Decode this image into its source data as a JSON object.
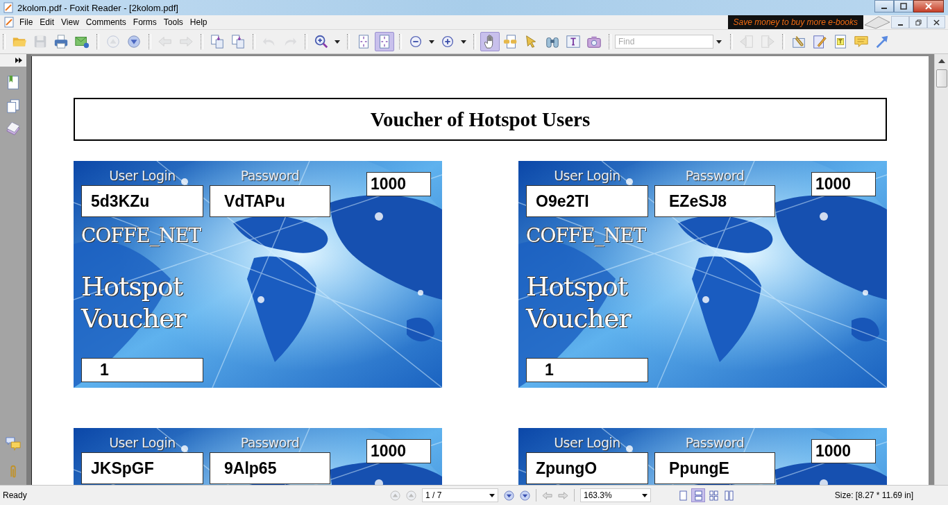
{
  "window": {
    "title": "2kolom.pdf - Foxit Reader - [2kolom.pdf]"
  },
  "menu": [
    "File",
    "Edit",
    "View",
    "Comments",
    "Forms",
    "Tools",
    "Help"
  ],
  "ad_banner": "Save money to buy more e-books",
  "toolbar": {
    "buttons": [
      {
        "selected": false,
        "disabled": false
      },
      {
        "selected": false,
        "disabled": true
      },
      {
        "selected": false,
        "disabled": false
      },
      {
        "selected": false,
        "disabled": false
      },
      {
        "selected": false,
        "disabled": true
      },
      {
        "selected": false,
        "disabled": false
      },
      {
        "selected": false,
        "disabled": true
      },
      {
        "selected": false,
        "disabled": true
      },
      {
        "selected": false,
        "disabled": false
      },
      {
        "selected": false,
        "disabled": false
      },
      {
        "selected": false,
        "disabled": true
      },
      {
        "selected": false,
        "disabled": true
      },
      {
        "selected": false,
        "disabled": false
      },
      {
        "selected": false,
        "disabled": false
      },
      {
        "selected": false,
        "disabled": false
      },
      {
        "selected": true,
        "disabled": false
      },
      {
        "selected": false,
        "disabled": false
      },
      {
        "selected": false,
        "disabled": false
      },
      {
        "selected": false,
        "disabled": false
      },
      {
        "selected": false,
        "disabled": false
      },
      {
        "selected": true,
        "disabled": false
      },
      {
        "selected": false,
        "disabled": false
      },
      {
        "selected": false,
        "disabled": false
      },
      {
        "selected": false,
        "disabled": false
      },
      {
        "selected": false,
        "disabled": false
      },
      {
        "selected": false,
        "disabled": false
      },
      {
        "selected": false,
        "disabled": true
      },
      {
        "selected": false,
        "disabled": true
      },
      {
        "selected": false,
        "disabled": false
      },
      {
        "selected": false,
        "disabled": false
      },
      {
        "selected": false,
        "disabled": false
      },
      {
        "selected": false,
        "disabled": false
      },
      {
        "selected": false,
        "disabled": false
      }
    ],
    "find": {
      "placeholder": "Find"
    }
  },
  "document": {
    "heading": "Voucher of Hotspot Users",
    "vouchers": [
      {
        "login_label": "User Login",
        "password_label": "Password",
        "login": "5d3KZu",
        "password": "VdTAPu",
        "price": "1000",
        "brand": "COFFE_NET",
        "title_lines": [
          "Hotspot",
          "Voucher"
        ],
        "number": "1"
      },
      {
        "login_label": "User Login",
        "password_label": "Password",
        "login": "O9e2TI",
        "password": "EZeSJ8",
        "price": "1000",
        "brand": "COFFE_NET",
        "title_lines": [
          "Hotspot",
          "Voucher"
        ],
        "number": "1"
      },
      {
        "login_label": "User Login",
        "password_label": "Password",
        "login": "JKSpGF",
        "password": "9Alp65",
        "price": "1000"
      },
      {
        "login_label": "User Login",
        "password_label": "Password",
        "login": "ZpungO",
        "password": "PpungE",
        "price": "1000"
      }
    ]
  },
  "status_bar": {
    "text": "Ready",
    "page": "1 / 7",
    "zoom": "163.3%",
    "size": "Size: [8.27 * 11.69 in]",
    "view_modes": [
      {
        "selected": false
      },
      {
        "selected": true
      },
      {
        "selected": false
      },
      {
        "selected": false
      }
    ]
  }
}
